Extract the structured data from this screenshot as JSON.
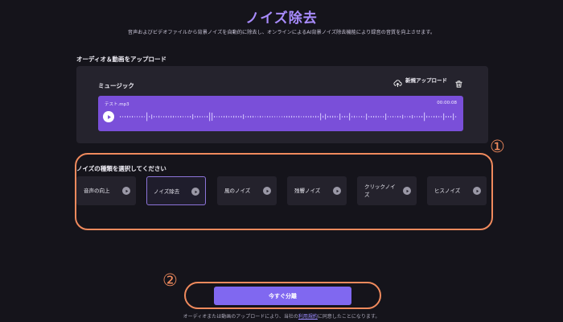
{
  "header": {
    "title": "ノイズ除去",
    "subtitle": "音声およびビデオファイルから背景ノイズを自動的に除去し、オンラインによるAI背景ノイズ除去機能により録音の音質を向上させます。"
  },
  "upload": {
    "section_label": "オーディオ＆動画をアップロード",
    "music_label": "ミュージック",
    "new_upload_label": "新規アップロード",
    "track": {
      "file_name": "テスト.mp3",
      "duration": "00:00:08"
    }
  },
  "noise": {
    "section_label": "ノイズの種類を選択してください",
    "callout": "①",
    "options": [
      {
        "label": "音声の向上"
      },
      {
        "label": "ノイズ除去"
      },
      {
        "label": "風のノイズ"
      },
      {
        "label": "残響ノイズ"
      },
      {
        "label": "クリックノイズ"
      },
      {
        "label": "ヒスノイズ"
      }
    ],
    "selected_index": 1
  },
  "action": {
    "callout": "②",
    "button_label": "今すぐ分離"
  },
  "footer": {
    "text_before": "オーディオまたは動画のアップロードにより、当社の",
    "link_text": "利用規約",
    "text_after": "に同意したことになります。"
  },
  "colors": {
    "accent": "#8068f0",
    "title": "#a98cff",
    "track": "#7a4fd9",
    "highlight": "#f08a5d",
    "background": "#15141b",
    "panel": "#25232d"
  },
  "icons": {
    "upload": "cloud-upload-icon",
    "delete": "trash-icon",
    "play": "play-icon"
  }
}
